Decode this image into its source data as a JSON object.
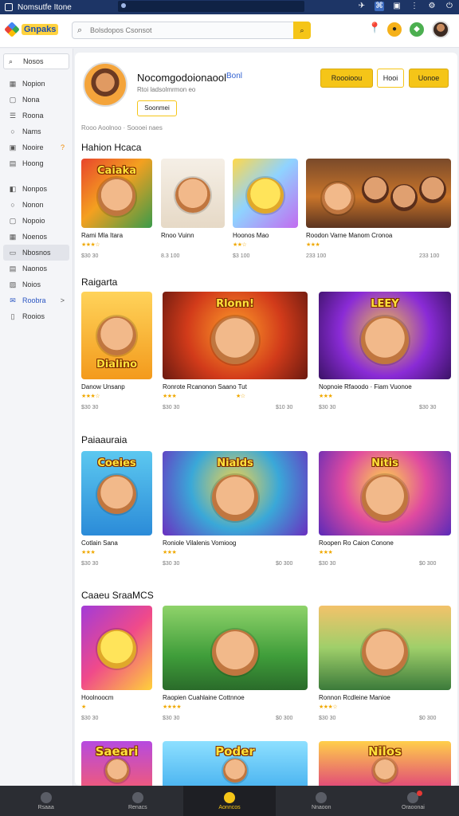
{
  "os": {
    "title": "Nomsutfe Itone"
  },
  "header": {
    "logo_text": "Gnpaks",
    "search_placeholder": "Bolsdopos Csonsot"
  },
  "sidebar": {
    "top_item": "Nosos",
    "items": [
      {
        "label": "Nopion",
        "icon": "grid-icon"
      },
      {
        "label": "Nona",
        "icon": "square-icon"
      },
      {
        "label": "Roona",
        "icon": "list-icon"
      },
      {
        "label": "Nams",
        "icon": "circle-icon"
      },
      {
        "label": "Nooire",
        "icon": "box-icon",
        "chevron": "?"
      },
      {
        "label": "Hoong",
        "icon": "doc-icon"
      }
    ],
    "items2": [
      {
        "label": "Nonpos",
        "icon": "bag-icon"
      },
      {
        "label": "Nonon",
        "icon": "circle-icon"
      },
      {
        "label": "Nopoio",
        "icon": "square-icon"
      },
      {
        "label": "Noenos",
        "icon": "grid-icon"
      },
      {
        "label": "Nbosnos",
        "icon": "folder-icon",
        "active": true
      },
      {
        "label": "Naonos",
        "icon": "doc-icon"
      },
      {
        "label": "Noios",
        "icon": "image-icon"
      },
      {
        "label": "Roobra",
        "icon": "mail-icon",
        "chevron": ">",
        "highlight": true
      },
      {
        "label": "Rooios",
        "icon": "page-icon"
      }
    ]
  },
  "profile": {
    "name": "Nocomgodoionaool",
    "badge": "Bonl",
    "subtitle": "Rtoi ladsolmrmon eo",
    "follow_button": "Soonmei",
    "breadcrumb": "Rooo Aoolnoo · Soooei naes"
  },
  "actions": {
    "primary": "Roooioou",
    "secondary": "Hooi",
    "tertiary": "Uonoe"
  },
  "sections": [
    {
      "title": "Hahion Hcaca",
      "tiles": [
        {
          "name": "Rami Mla Itara",
          "stars": "★★★☆",
          "meta": "$30 30"
        },
        {
          "name": "Rnoo Vuinn",
          "stars": "",
          "meta": "8.3 100"
        },
        {
          "name": "Hoonos Mao",
          "stars": "★★☆",
          "meta": "$3 100"
        },
        {
          "name": "Roodon Varne Manom  Cronoa",
          "stars": "★★★",
          "meta": "233 100",
          "meta2": "233 100"
        }
      ]
    },
    {
      "title": "Raigarta",
      "tiles": [
        {
          "name": "Danow Unsanp",
          "stars": "★★★☆",
          "meta": "$30 30"
        },
        {
          "name": "Ronrote Rcanonon  Saano Tut",
          "stars": "★★★",
          "meta": "$30 30",
          "stars2": "★☆",
          "meta2": "$10 30"
        },
        {
          "name": "Nopnoie Rfaoodo · Fiam Vuonoe",
          "stars": "★★★",
          "meta": "$30 30",
          "meta2": "$30 30"
        }
      ]
    },
    {
      "title": "Paiaauraia",
      "tiles": [
        {
          "name": "Cotlain Sana",
          "stars": "★★★",
          "meta": "$30 30"
        },
        {
          "name": "Roniole Vilalenis    Vomioog",
          "stars": "★★★",
          "meta": "$30 30",
          "meta2": "$0 300"
        },
        {
          "name": "Roopen  Ro Caion   Conone",
          "stars": "★★★",
          "meta": "$30 30",
          "meta2": "$0 300"
        }
      ]
    },
    {
      "title": "Caaeu SraaMCS",
      "tiles": [
        {
          "name": "Hoolnoocm",
          "stars": "★",
          "meta": "$30 30"
        },
        {
          "name": "Raopien Cuahlaine   Cottnnoe",
          "stars": "★★★★",
          "meta": "$30 30",
          "meta2": "$0 300"
        },
        {
          "name": "Ronnon Rcdleine    Manioe",
          "stars": "★★★☆",
          "meta": "$30 30",
          "meta2": "$0 300"
        }
      ]
    },
    {
      "title": "",
      "tiles": [
        {
          "art": "Saeari"
        },
        {
          "art": "Poder"
        },
        {
          "art": "Nilos"
        }
      ]
    }
  ],
  "art_labels": {
    "s1": "Caiaka",
    "s2_1": "Dialino",
    "s2_2": "Rlonn!",
    "s2_3": "LEEY",
    "s3_1": "Coeies",
    "s3_2": "Nialds",
    "s3_3": "Nitis",
    "s5_1": "Saeari",
    "s5_2": "Poder",
    "s5_3": "Nilos"
  },
  "bottom_nav": [
    {
      "label": "Rsaaa",
      "icon": "home-icon"
    },
    {
      "label": "Renacs",
      "icon": "people-icon"
    },
    {
      "label": "Aonncos",
      "icon": "notification-icon",
      "active": true
    },
    {
      "label": "Nnaoon",
      "icon": "chat-icon"
    },
    {
      "label": "Oraoonai",
      "icon": "profile-icon",
      "dot": true
    }
  ]
}
